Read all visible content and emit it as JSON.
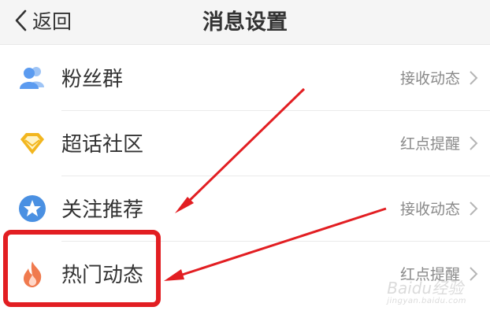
{
  "header": {
    "back_label": "返回",
    "title": "消息设置"
  },
  "rows": [
    {
      "label": "粉丝群",
      "status": "接收动态",
      "icon": "fans-group-icon",
      "color": "#5b9bf0"
    },
    {
      "label": "超话社区",
      "status": "红点提醒",
      "icon": "diamond-icon",
      "color": "#f2b61f"
    },
    {
      "label": "关注推荐",
      "status": "接收动态",
      "icon": "star-badge-icon",
      "color": "#4a90e2"
    },
    {
      "label": "热门动态",
      "status": "红点提醒",
      "icon": "flame-icon",
      "color": "#f07a4e"
    }
  ],
  "watermark": {
    "brand": "Baidu经验",
    "url": "jingyan.baidu.com"
  },
  "colors": {
    "annotation": "#e21e22"
  }
}
